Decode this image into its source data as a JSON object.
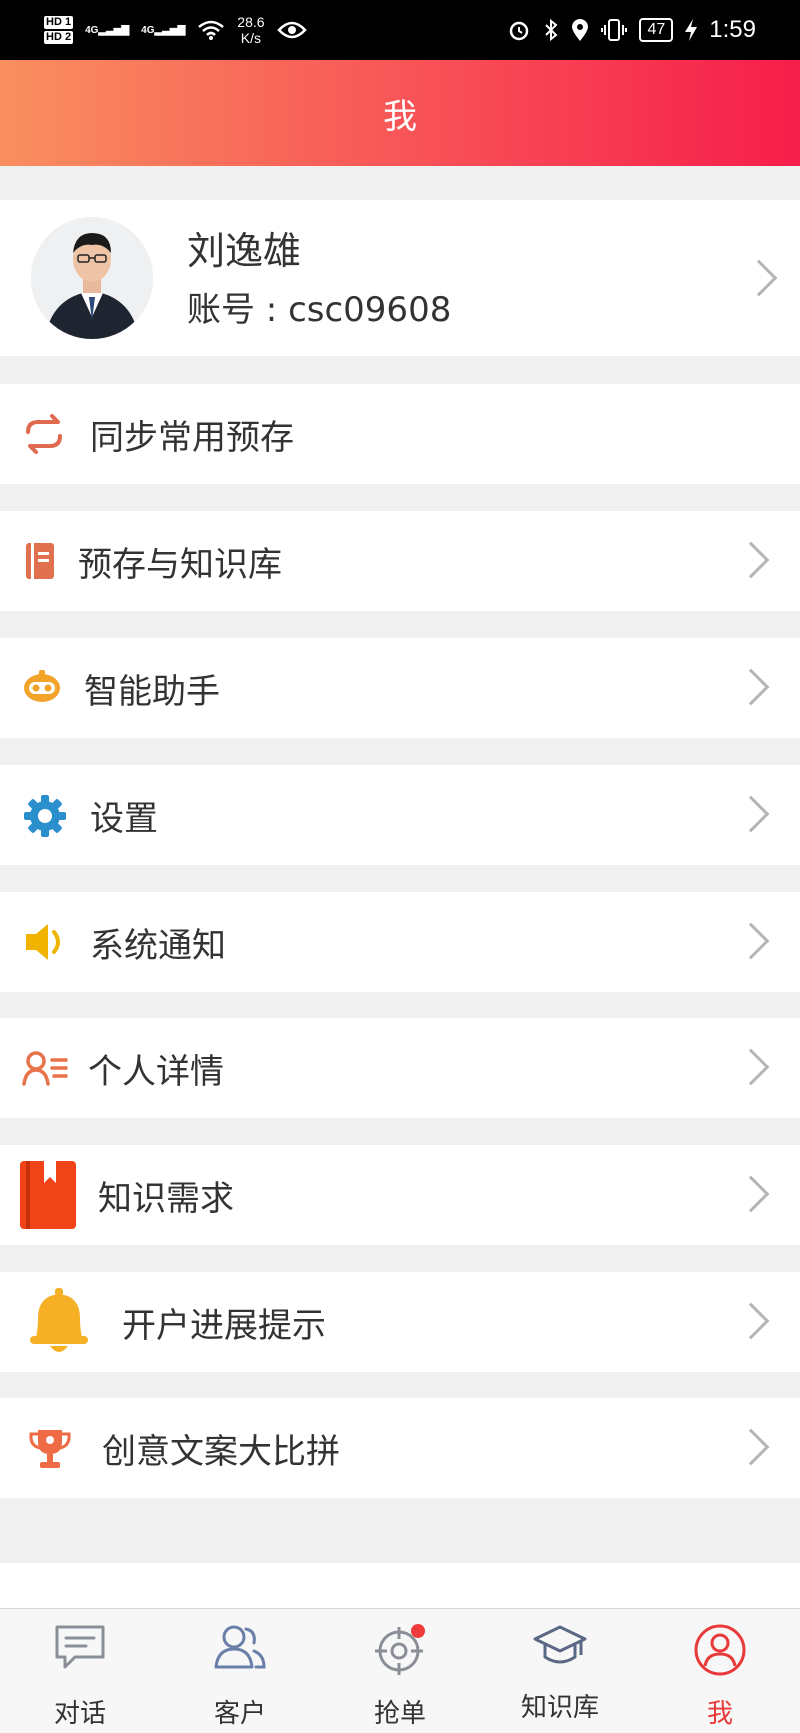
{
  "status_bar": {
    "hd1": "HD 1",
    "hd2": "HD 2",
    "net1": "4G",
    "net2": "4G",
    "speed_value": "28.6",
    "speed_unit": "K/s",
    "battery": "47",
    "time": "1:59"
  },
  "header": {
    "title": "我"
  },
  "profile": {
    "name": "刘逸雄",
    "account": "账号 : csc09608"
  },
  "menu": [
    {
      "label": "同步常用预存",
      "icon": "sync-icon",
      "color": "#e06a4f"
    },
    {
      "label": "预存与知识库",
      "icon": "book-icon",
      "color": "#e0704e"
    },
    {
      "label": "智能助手",
      "icon": "robot-icon",
      "color": "#f3a32a"
    },
    {
      "label": "设置",
      "icon": "gear-icon",
      "color": "#2a8fcc"
    },
    {
      "label": "系统通知",
      "icon": "speaker-icon",
      "color": "#f0b400"
    },
    {
      "label": "个人详情",
      "icon": "person-list-icon",
      "color": "#e8734a"
    },
    {
      "label": "知识需求",
      "icon": "red-book-icon",
      "color": "#f04418"
    },
    {
      "label": "开户进展提示",
      "icon": "bell-icon",
      "color": "#f5b026"
    },
    {
      "label": "创意文案大比拼",
      "icon": "trophy-icon",
      "color": "#ee6b46"
    }
  ],
  "tabs": [
    {
      "label": "对话",
      "icon": "chat-icon"
    },
    {
      "label": "客户",
      "icon": "customers-icon"
    },
    {
      "label": "抢单",
      "icon": "target-icon"
    },
    {
      "label": "知识库",
      "icon": "graduation-cap-icon"
    },
    {
      "label": "我",
      "icon": "profile-icon",
      "active": true
    }
  ],
  "colors": {
    "accent": "#e83a3a",
    "header_start": "#f98f5f",
    "header_end": "#f61d4a"
  }
}
